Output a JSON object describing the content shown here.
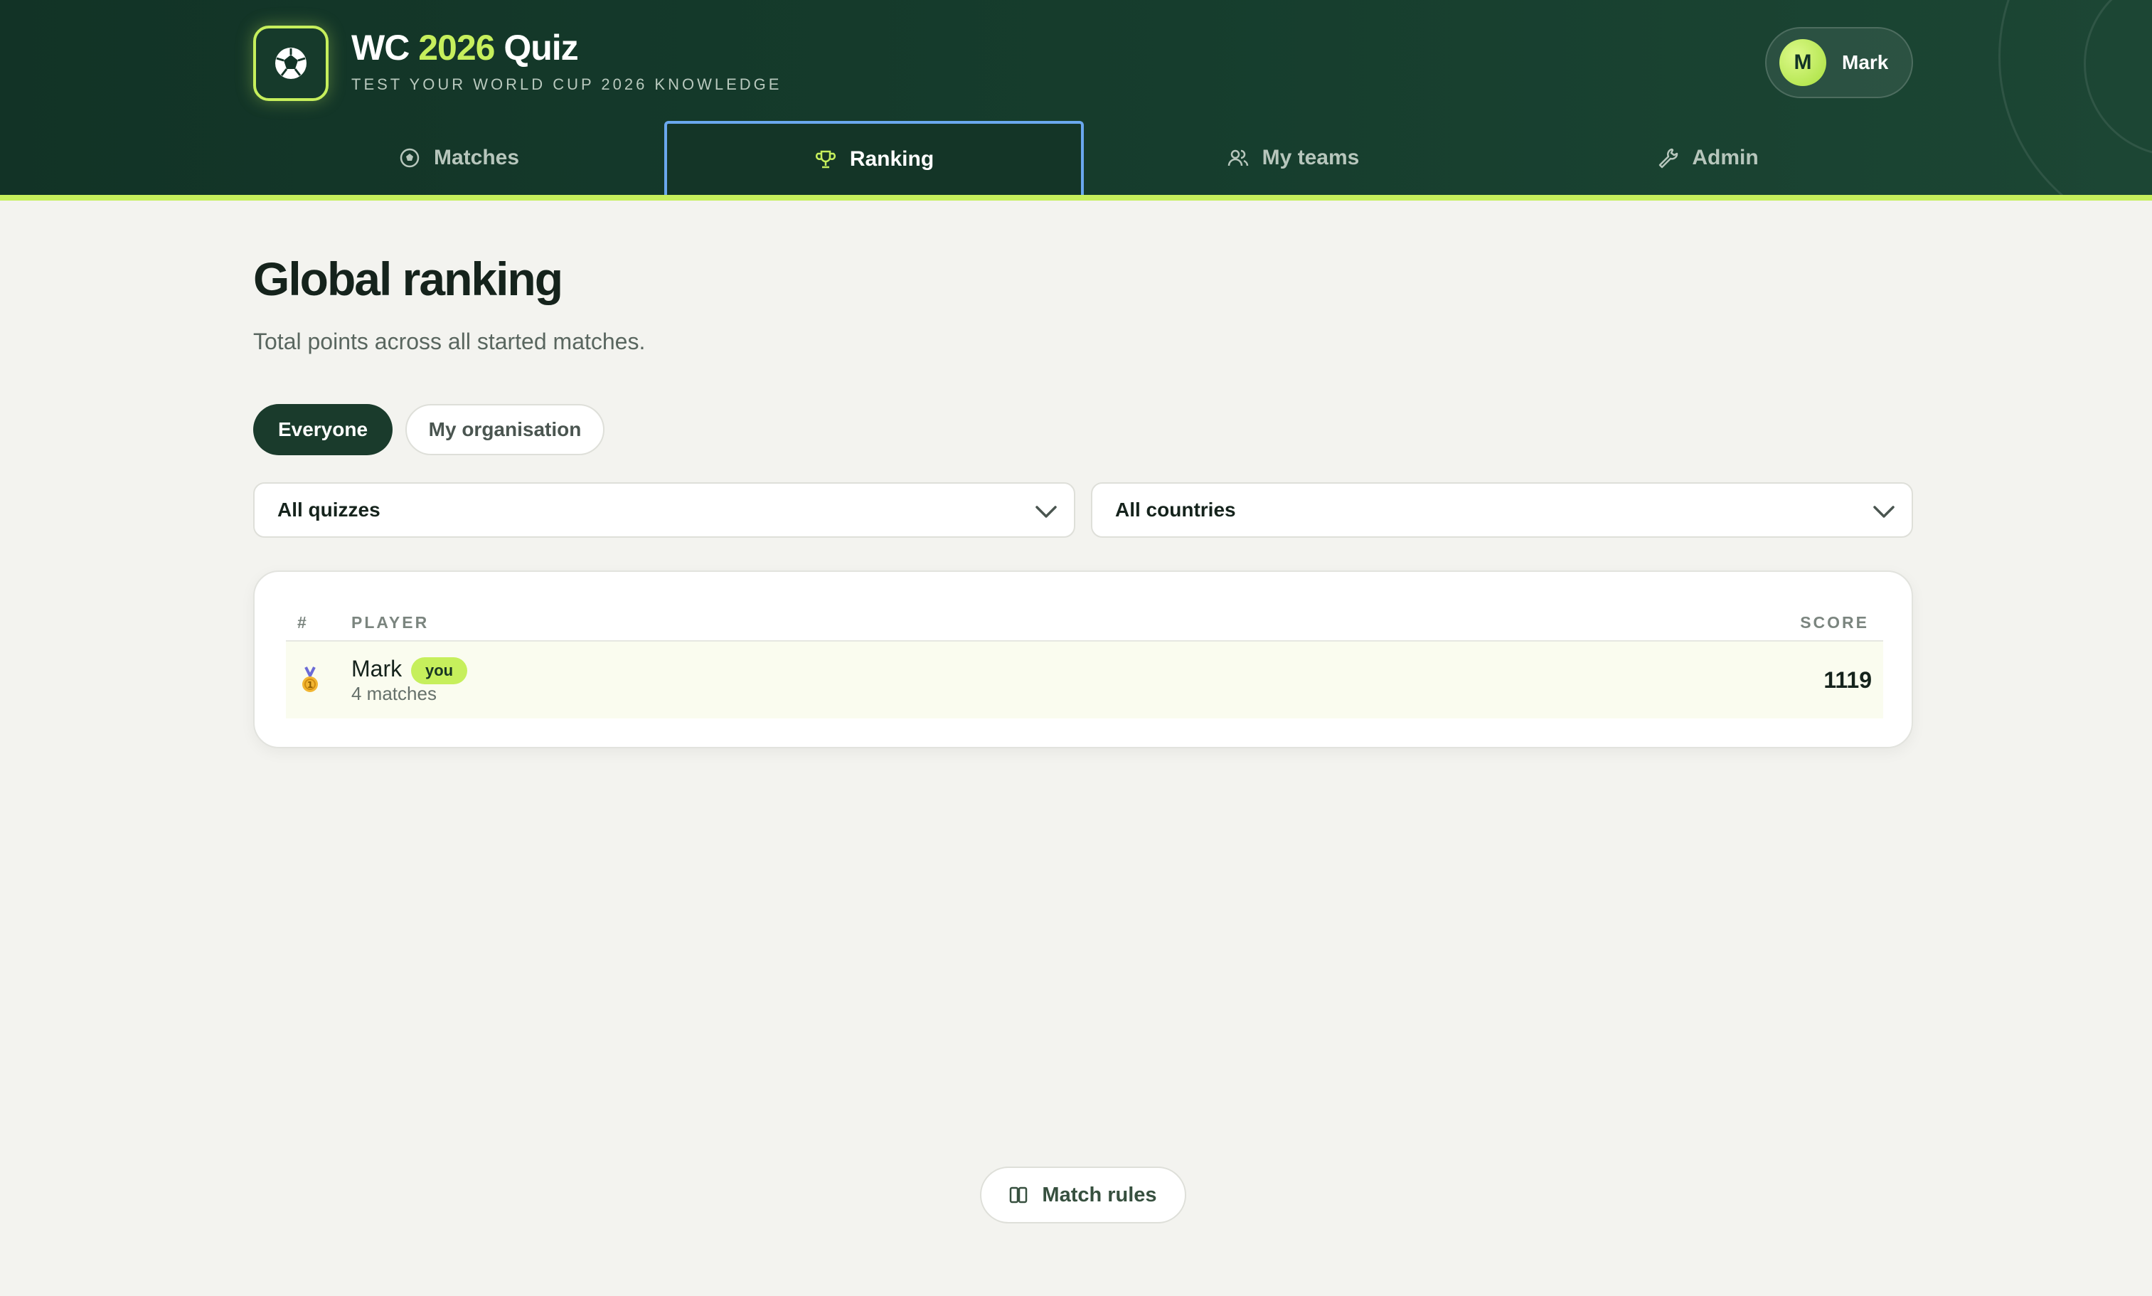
{
  "header": {
    "title_prefix": "WC",
    "title_year": "2026",
    "title_suffix": "Quiz",
    "subtitle": "TEST YOUR WORLD CUP 2026 KNOWLEDGE",
    "logo_icon": "soccer-ball-icon",
    "user": {
      "initial": "M",
      "name": "Mark"
    }
  },
  "nav": {
    "tabs": [
      {
        "label": "Matches",
        "icon": "soccer-ball-icon"
      },
      {
        "label": "Ranking",
        "icon": "trophy-icon",
        "active": true
      },
      {
        "label": "My teams",
        "icon": "users-icon"
      },
      {
        "label": "Admin",
        "icon": "wrench-icon"
      }
    ]
  },
  "main": {
    "title": "Global ranking",
    "description": "Total points across all started matches.",
    "scope": {
      "everyone": "Everyone",
      "organisation": "My organisation",
      "selected": "Everyone"
    },
    "filters": {
      "quiz": "All quizzes",
      "country": "All countries"
    },
    "table": {
      "headers": {
        "rank": "#",
        "player": "PLAYER",
        "score": "SCORE"
      },
      "rows": [
        {
          "rank_icon": "gold-medal-icon",
          "name": "Mark",
          "badge": "you",
          "matches": "4 matches",
          "score": "1119"
        }
      ]
    },
    "rules_button": "Match rules"
  },
  "colors": {
    "header_bg": "#123326",
    "accent": "#c6ef5c",
    "active_tab_border": "#6aa8ee",
    "page_bg": "#f3f3ef"
  }
}
